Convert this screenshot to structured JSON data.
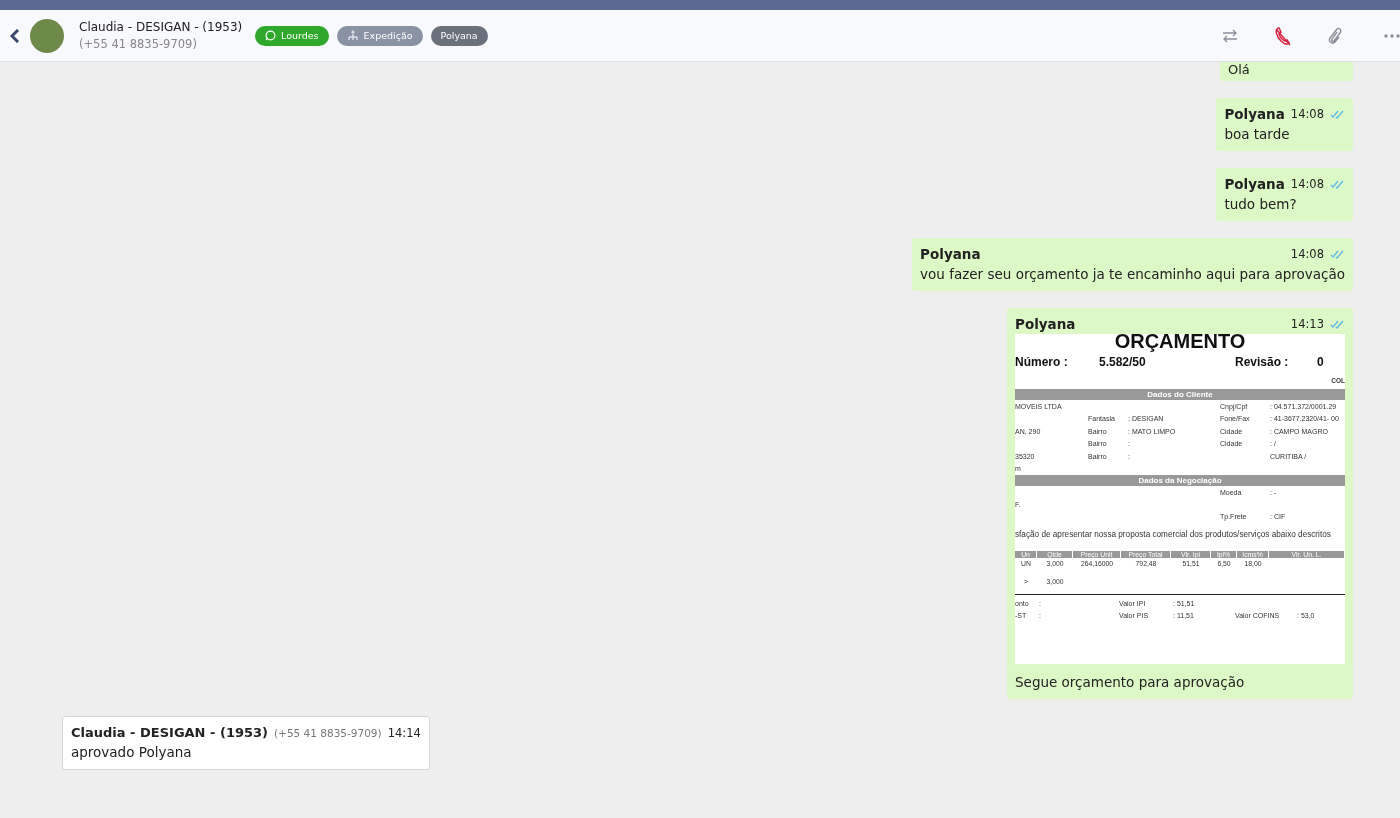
{
  "header": {
    "contact_name": "Claudia - DESIGAN - (1953)",
    "contact_phone": "(+55 41 8835-9709)",
    "tags": [
      {
        "kind": "whatsapp",
        "label": "Lourdes",
        "color": "#2fa82b"
      },
      {
        "kind": "team",
        "label": "Expedição",
        "color": "#8a92a5"
      },
      {
        "kind": "plain",
        "label": "Polyana",
        "color": "#6b717b"
      }
    ]
  },
  "messages": [
    {
      "kind": "text",
      "outgoing": true,
      "text": "Olá"
    },
    {
      "kind": "text",
      "outgoing": true,
      "sender": "Polyana",
      "time": "14:08",
      "read": true,
      "text": "boa tarde"
    },
    {
      "kind": "text",
      "outgoing": true,
      "sender": "Polyana",
      "time": "14:08",
      "read": true,
      "text": "tudo bem?"
    },
    {
      "kind": "text",
      "outgoing": true,
      "sender": "Polyana",
      "time": "14:08",
      "read": true,
      "text": "vou fazer seu orçamento ja te encaminho aqui para aprovação"
    },
    {
      "kind": "document",
      "outgoing": true,
      "sender": "Polyana",
      "time": "14:13",
      "read": true,
      "caption": "Segue orçamento para aprovação",
      "document": {
        "title": "ORÇAMENTO",
        "numero_label": "Número :",
        "numero": "5.582/50",
        "revisao_label": "Revisão :",
        "revisao": "0",
        "corner": "COL",
        "client_section": "Dados do Cliente",
        "client_rows": [
          {
            "col_1": "MOVEIS LTDA",
            "col_4": "Cnpj/Cpf",
            "col_5": ": 04.571.372/0001.29"
          },
          {
            "col_2": "Fantasia",
            "col_3": ": DESIGAN",
            "col_4": "Fone/Fax",
            "col_5": ": 41-3677.2320/41- 00"
          },
          {
            "col_1": "AN, 290",
            "col_2": "Bairro",
            "col_3": ": MATO LIMPO",
            "col_4": "Cidade",
            "col_5": ": CAMPO MAGRO"
          },
          {
            "col_2": "Bairro",
            "col_3": ":",
            "col_4": "Cidade",
            "col_5": ": /"
          },
          {
            "col_1": "35320",
            "col_2": "Bairro",
            "col_3": ":",
            "col_5": "CURITIBA /"
          },
          {
            "col_1": "m"
          }
        ],
        "negotiation_section": "Dados da Negociação",
        "negotiation_rows": [
          {
            "col_4": "Moeda",
            "col_5": ": -"
          },
          {
            "col_1": "F."
          },
          {
            "col_4": "Tp.Frete",
            "col_5": ": CIF"
          }
        ],
        "intro": "sfação de apresentar nossa proposta comercial dos produtos/serviços abaixo descritos",
        "item_columns": [
          "Un",
          "Qtde",
          "Preço Unit",
          "Preço Total",
          "Vlr. Ipi",
          "Ipi%",
          "Icms%",
          "Vlr. Un. L."
        ],
        "item_rows": [
          [
            "UN",
            "3,000",
            "264,16000",
            "792,48",
            "51,51",
            "6,50",
            "18,00"
          ],
          [
            ">",
            "3,000"
          ]
        ],
        "totals": [
          [
            "onto",
            ":",
            "Valor IPI",
            ": 51,51"
          ],
          [
            "-ST",
            ":",
            "Valor PIS",
            ": 11,51",
            "Valor COFINS",
            ": 53,0"
          ]
        ]
      }
    },
    {
      "kind": "text",
      "outgoing": false,
      "sender": "Claudia - DESIGAN - (1953)",
      "phone": "(+55 41 8835-9709)",
      "time": "14:14",
      "text": "aprovado Polyana"
    }
  ]
}
